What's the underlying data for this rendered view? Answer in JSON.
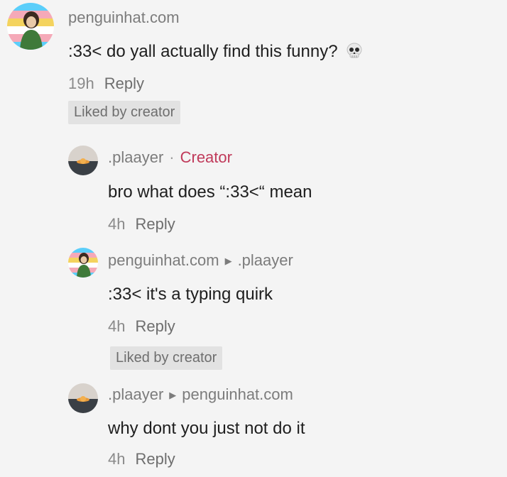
{
  "comments": [
    {
      "username": "penguinhat.com",
      "text": ":33< do yall actually find this funny?",
      "emoji_icon": "skull-icon",
      "time": "19h",
      "reply_label": "Reply",
      "liked_label": "Liked by creator"
    },
    {
      "username": ".plaayer",
      "separator": "·",
      "creator_label": "Creator",
      "text": "bro what does “:33<“ mean",
      "time": "4h",
      "reply_label": "Reply"
    },
    {
      "username": "penguinhat.com",
      "reply_to": ".plaayer",
      "text": ":33< it's a typing quirk",
      "time": "4h",
      "reply_label": "Reply",
      "liked_label": "Liked by creator"
    },
    {
      "username": ".plaayer",
      "reply_to": "penguinhat.com",
      "text": "why dont you just not do it",
      "time": "4h",
      "reply_label": "Reply"
    }
  ],
  "colors": {
    "creator": "#c03a5a",
    "background": "#f4f4f4",
    "liked_badge": "#e2e2e2"
  }
}
